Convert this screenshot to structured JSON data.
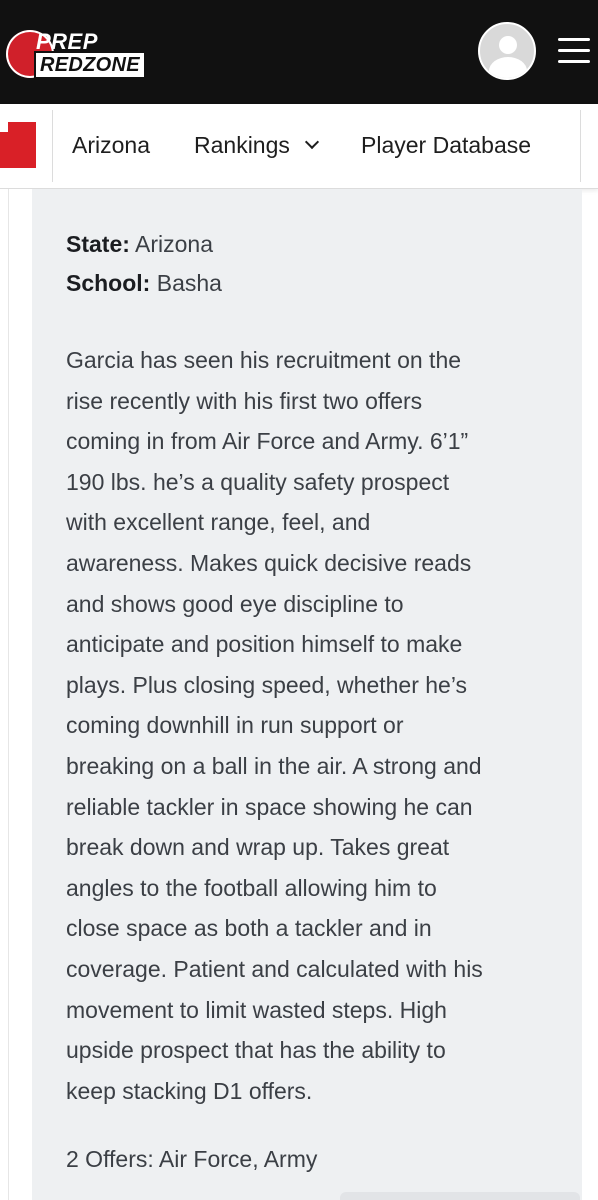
{
  "header": {
    "logo_top": "PREP",
    "logo_bottom": "REDZONE",
    "brand_color": "#d0202a",
    "avatar_icon": "user-avatar-icon",
    "menu_icon": "hamburger-menu-icon"
  },
  "nav": {
    "items": [
      {
        "label": "Arizona"
      },
      {
        "label": "Rankings"
      },
      {
        "label": "Player Database"
      }
    ],
    "state_icon": "arizona-state-icon"
  },
  "profile": {
    "state_label": "State:",
    "state_value": "Arizona",
    "school_label": "School:",
    "school_value": "Basha"
  },
  "description": {
    "lines": [
      "Garcia has seen his recruitment on the",
      "rise recently with his first two offers",
      "coming in from Air Force and Army. 6’1”",
      "190 lbs. he’s a quality safety prospect",
      "with excellent range, feel, and",
      "awareness. Makes quick decisive reads",
      "and shows good eye discipline to",
      "anticipate and position himself to make",
      "plays. Plus closing speed, whether he’s",
      "coming downhill in run support or",
      "breaking on a ball in the air. A strong and",
      "reliable tackler in space showing he can",
      "break down and wrap up. Takes great",
      "angles to the football allowing him to",
      "close space as both a tackler and in",
      "coverage. Patient and calculated with his",
      "movement to limit wasted steps. High",
      "upside prospect that has the ability to",
      "keep stacking D1 offers."
    ]
  },
  "offers": {
    "text": "2 Offers: Air Force, Army"
  }
}
